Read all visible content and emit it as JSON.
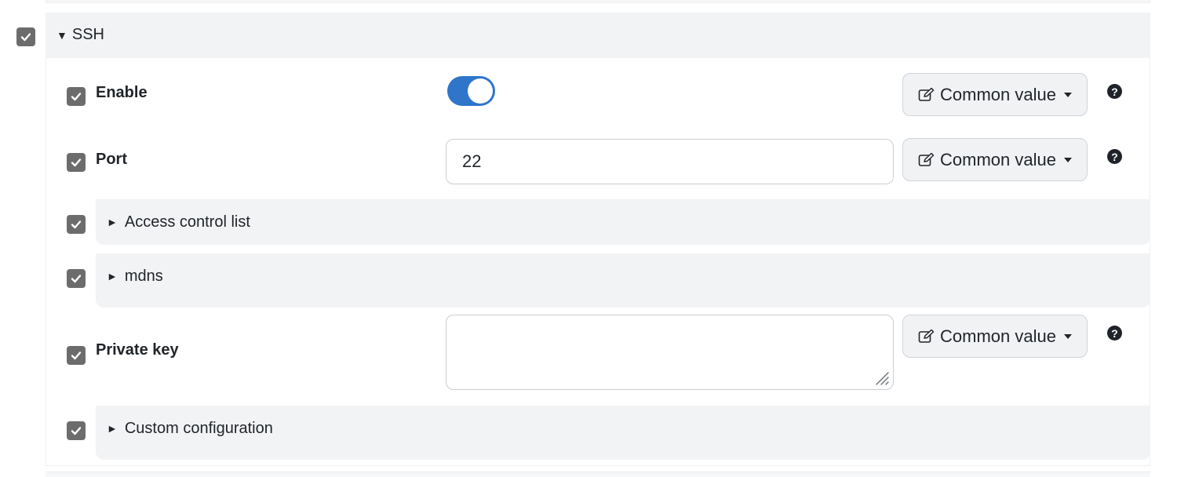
{
  "ssh": {
    "title": "SSH",
    "checked": true,
    "expanded": true
  },
  "fields": {
    "enable": {
      "label": "Enable",
      "value": true,
      "checked": true
    },
    "port": {
      "label": "Port",
      "value": "22",
      "checked": true
    },
    "private_key": {
      "label": "Private key",
      "value": "",
      "checked": true
    }
  },
  "sections": {
    "acl": {
      "title": "Access control list",
      "checked": true,
      "expanded": false
    },
    "mdns": {
      "title": "mdns",
      "checked": true,
      "expanded": false
    },
    "custom": {
      "title": "Custom configuration",
      "checked": true,
      "expanded": false
    }
  },
  "common_value_label": "Common value",
  "help_glyph": "?",
  "icons": {
    "collapse": "caret-down-icon",
    "expand": "caret-right-icon",
    "edit": "edit-icon",
    "dropdown": "dropdown-caret-icon",
    "help": "question-circle-icon",
    "checkbox": "check-icon"
  },
  "colors": {
    "toggle_on": "#2f75c9",
    "checkbox": "#6c6c6c",
    "panel_bg": "#f2f3f5"
  }
}
